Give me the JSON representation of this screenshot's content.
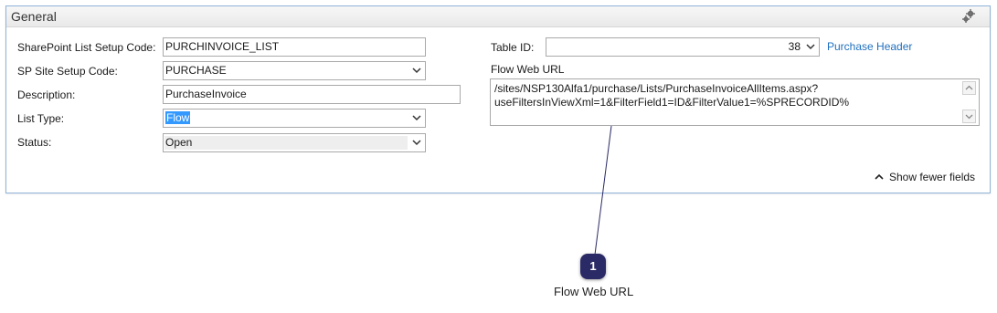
{
  "panel": {
    "title": "General"
  },
  "left_fields": {
    "list_setup_code": {
      "label": "SharePoint List Setup Code:",
      "value": "PURCHINVOICE_LIST"
    },
    "site_setup_code": {
      "label": "SP Site Setup Code:",
      "value": "PURCHASE"
    },
    "description": {
      "label": "Description:",
      "value": "PurchaseInvoice"
    },
    "list_type": {
      "label": "List Type:",
      "value": "Flow"
    },
    "status": {
      "label": "Status:",
      "value": "Open"
    }
  },
  "right_fields": {
    "table_id": {
      "label": "Table ID:",
      "value": "38",
      "link": "Purchase Header"
    },
    "flow_web_url": {
      "label": "Flow Web URL",
      "line1": "/sites/NSP130Alfa1/purchase/Lists/PurchaseInvoiceAllItems.aspx?",
      "line2": "useFiltersInViewXml=1&FilterField1=ID&FilterValue1=%SPRECORDID%"
    }
  },
  "footer": {
    "show_fewer": "Show fewer fields"
  },
  "callout": {
    "number": "1",
    "label": "Flow Web URL"
  },
  "colors": {
    "accent": "#1f6fbf",
    "badge": "#2a2a66",
    "selection": "#3399ff"
  },
  "icons": [
    "gear-icon",
    "chevron-down-icon",
    "chevron-up-icon"
  ]
}
